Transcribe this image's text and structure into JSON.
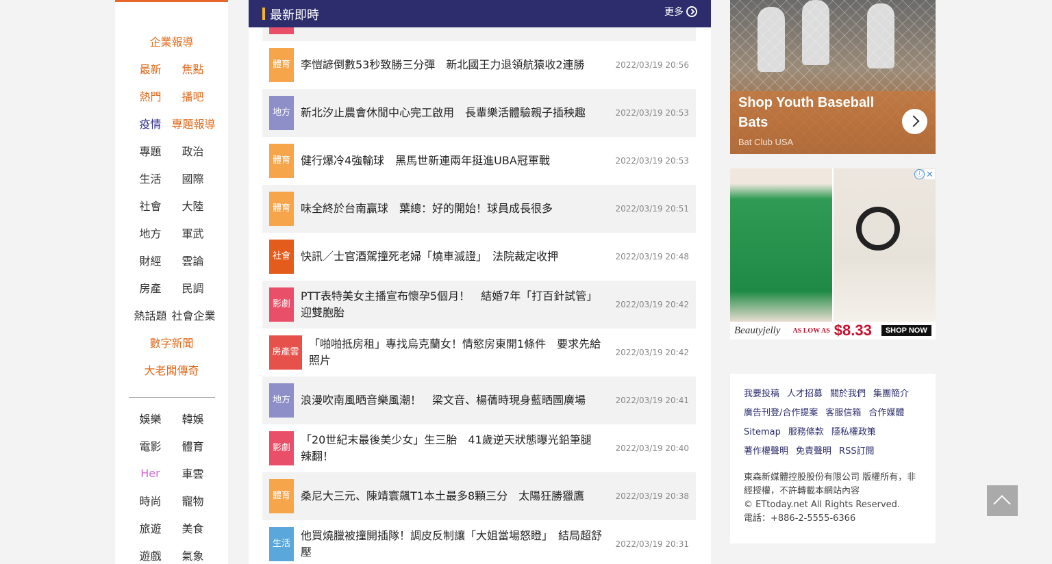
{
  "leftnav": {
    "rows": [
      [
        {
          "label": "企業報導",
          "color": "#e06a1b"
        }
      ],
      [
        {
          "label": "最新",
          "color": "#e06a1b"
        },
        {
          "label": "焦點",
          "color": "#e06a1b"
        }
      ],
      [
        {
          "label": "熱門",
          "color": "#e06a1b"
        },
        {
          "label": "播吧",
          "color": "#e06a1b"
        }
      ],
      [
        {
          "label": "疫情",
          "color": "#2d2d8f"
        },
        {
          "label": "專題報導",
          "color": "#e06a1b"
        }
      ],
      [
        {
          "label": "專題",
          "color": "#333333"
        },
        {
          "label": "政治",
          "color": "#333333"
        }
      ],
      [
        {
          "label": "生活",
          "color": "#333333"
        },
        {
          "label": "國際",
          "color": "#333333"
        }
      ],
      [
        {
          "label": "社會",
          "color": "#333333"
        },
        {
          "label": "大陸",
          "color": "#333333"
        }
      ],
      [
        {
          "label": "地方",
          "color": "#333333"
        },
        {
          "label": "軍武",
          "color": "#333333"
        }
      ],
      [
        {
          "label": "財經",
          "color": "#333333"
        },
        {
          "label": "雲論",
          "color": "#333333"
        }
      ],
      [
        {
          "label": "房產",
          "color": "#333333"
        },
        {
          "label": "民調",
          "color": "#333333"
        }
      ],
      [
        {
          "label": "熱話題",
          "color": "#333333"
        },
        {
          "label": "社會企業",
          "color": "#333333"
        }
      ],
      [
        {
          "label": "數字新聞",
          "color": "#e06a1b"
        }
      ],
      [
        {
          "label": "大老闆傳奇",
          "color": "#e06a1b"
        }
      ]
    ],
    "rows2": [
      [
        {
          "label": "娛樂",
          "color": "#333333"
        },
        {
          "label": "韓娛",
          "color": "#333333"
        }
      ],
      [
        {
          "label": "電影",
          "color": "#333333"
        },
        {
          "label": "體育",
          "color": "#333333"
        }
      ],
      [
        {
          "label": "Her",
          "color": "#d36ad6"
        },
        {
          "label": "車雲",
          "color": "#333333"
        }
      ],
      [
        {
          "label": "時尚",
          "color": "#333333"
        },
        {
          "label": "寵物",
          "color": "#333333"
        }
      ],
      [
        {
          "label": "旅遊",
          "color": "#333333"
        },
        {
          "label": "美食",
          "color": "#333333"
        }
      ],
      [
        {
          "label": "遊戲",
          "color": "#333333"
        },
        {
          "label": "氣象",
          "color": "#333333"
        }
      ]
    ]
  },
  "latest": {
    "title": "最新即時",
    "more": "更多",
    "news": [
      {
        "tag": "",
        "tag_color": "#ea4f6a",
        "headline": "",
        "time": ""
      },
      {
        "tag": "體育",
        "tag_color": "#f6a54b",
        "headline": "李愷諺倒數53秒致勝三分彈　新北國王力退領航猿收2連勝",
        "time": "2022/03/19 20:56"
      },
      {
        "tag": "地方",
        "tag_color": "#8e8ec9",
        "headline": "新北汐止農會休閒中心完工啟用　長輩樂活體驗親子插秧趣",
        "time": "2022/03/19 20:53"
      },
      {
        "tag": "體育",
        "tag_color": "#f6a54b",
        "headline": "健行爆冷4強輸球　黑馬世新連兩年挺進UBA冠軍戰",
        "time": "2022/03/19 20:53"
      },
      {
        "tag": "體育",
        "tag_color": "#f6a54b",
        "headline": "味全終於台南贏球　葉總：好的開始！球員成長很多",
        "time": "2022/03/19 20:51"
      },
      {
        "tag": "社會",
        "tag_color": "#e45c1c",
        "headline": "快訊／士官酒駕撞死老婦「燒車滅證」　法院裁定收押",
        "time": "2022/03/19 20:48"
      },
      {
        "tag": "影劇",
        "tag_color": "#ea4f6a",
        "headline": "PTT表特美女主播宣布懷孕5個月！　結婚7年「打百針試管」迎雙胞胎",
        "time": "2022/03/19 20:42"
      },
      {
        "tag": "房產雲",
        "tag_color": "#e6524b",
        "headline": "「啪啪抵房租」專找烏克蘭女！情慾房東開1條件　要求先給照片",
        "time": "2022/03/19 20:42"
      },
      {
        "tag": "地方",
        "tag_color": "#8e8ec9",
        "headline": "浪漫吹南風晒音樂風潮！　梁文音、楊蒨時現身藍晒圖廣場",
        "time": "2022/03/19 20:41"
      },
      {
        "tag": "影劇",
        "tag_color": "#ea4f6a",
        "headline": "「20世紀末最後美少女」生三胎　41歲逆天狀態曝光鉛筆腿辣翻！",
        "time": "2022/03/19 20:40"
      },
      {
        "tag": "體育",
        "tag_color": "#f6a54b",
        "headline": "桑尼大三元、陳靖寰飆T1本土最多8顆三分　太陽狂勝獵鷹",
        "time": "2022/03/19 20:38"
      },
      {
        "tag": "生活",
        "tag_color": "#5aa7dc",
        "headline": "他買燒臘被撞開插隊！調皮反制讓「大姐當場怒瞪」　結局超舒壓",
        "time": "2022/03/19 20:31"
      }
    ]
  },
  "ad1": {
    "title": "Shop Youth Baseball Bats",
    "source": "Bat Club USA",
    "icon": "chevron-right-icon"
  },
  "ad2": {
    "brand": "Beautyjelly",
    "as_low_as": "AS LOW AS",
    "price": "$8.33",
    "cta": "SHOP NOW",
    "info": "ⓘ",
    "close": "✕"
  },
  "footer": {
    "links": [
      "我要投稿",
      "人才招募",
      "關於我們",
      "集團簡介",
      "廣告刊登/合作提案",
      "客服信箱",
      "合作媒體",
      "Sitemap",
      "服務條款",
      "隱私權政策",
      "著作權聲明",
      "免責聲明",
      "RSS訂閱"
    ],
    "copyright": "東森新媒體控股股份有限公司 版權所有，非經授權，不許轉載本網站內容",
    "rights": "© ETtoday.net All Rights Reserved.",
    "phone": "電話：+886-2-5555-6366"
  }
}
